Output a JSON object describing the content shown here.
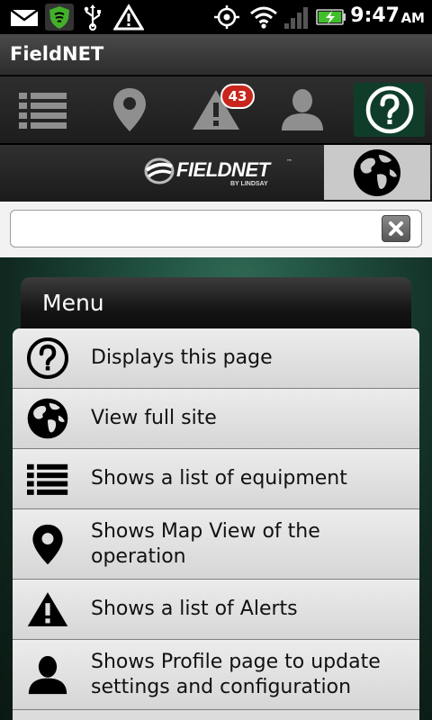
{
  "status_bar": {
    "time": "9:47",
    "ampm": "AM",
    "icons": [
      "mail-icon",
      "shield-icon",
      "usb-icon",
      "warning-icon",
      "gps-icon",
      "wifi-icon",
      "signal-icon",
      "battery-charging-icon"
    ]
  },
  "app": {
    "title": "FieldNET"
  },
  "toolbar": {
    "buttons": [
      "list-icon",
      "map-pin-icon",
      "alert-icon",
      "profile-icon",
      "help-icon"
    ],
    "alert_count": "43"
  },
  "logo": {
    "word": "FIELDNET",
    "tm": "™",
    "sub": "BY LINDSAY"
  },
  "search": {
    "value": "",
    "placeholder": ""
  },
  "menu": {
    "title": "Menu",
    "items": [
      {
        "icon": "help-icon",
        "label": "Displays this page"
      },
      {
        "icon": "globe-icon",
        "label": "View full site"
      },
      {
        "icon": "list-icon",
        "label": "Shows a list of equipment"
      },
      {
        "icon": "map-pin-icon",
        "label": "Shows Map View of the operation"
      },
      {
        "icon": "alert-icon",
        "label": "Shows a list of Alerts"
      },
      {
        "icon": "profile-icon",
        "label": "Shows Profile page to update settings and configuration"
      }
    ]
  },
  "colors": {
    "help_active_bg": "#0f3d2a",
    "badge": "#c8261d",
    "background_green": "#1d4a3b"
  }
}
